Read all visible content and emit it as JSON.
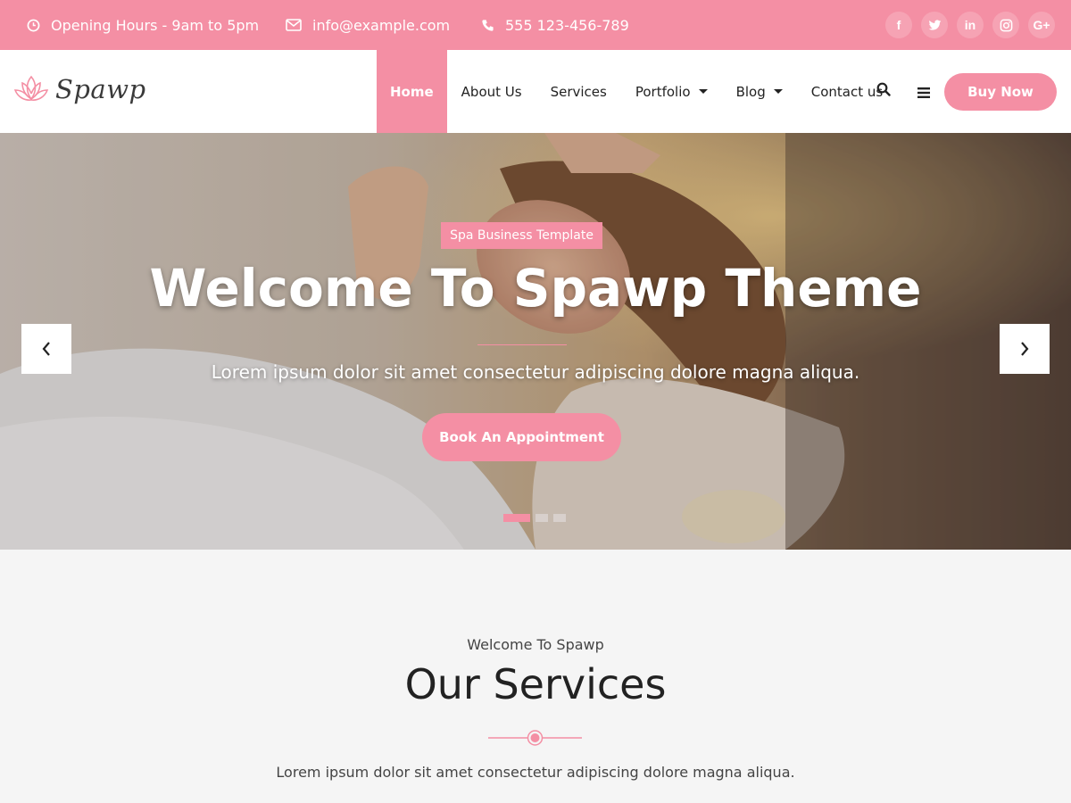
{
  "topbar": {
    "hours": "Opening Hours - 9am to 5pm",
    "email": "info@example.com",
    "phone": "555 123-456-789",
    "social": [
      {
        "icon": "facebook-icon",
        "glyph": "f"
      },
      {
        "icon": "twitter-icon",
        "glyph": "t"
      },
      {
        "icon": "linkedin-icon",
        "glyph": "in"
      },
      {
        "icon": "instagram-icon",
        "glyph": "ig"
      },
      {
        "icon": "google-plus-icon",
        "glyph": "G+"
      }
    ]
  },
  "header": {
    "logo_text": "Spawp",
    "nav": [
      "Home",
      "About Us",
      "Services",
      "Portfolio",
      "Blog",
      "Contact us"
    ],
    "buy_label": "Buy Now"
  },
  "hero": {
    "tag": "Spa Business Template",
    "title": "Welcome To Spawp Theme",
    "subtitle": "Lorem ipsum dolor sit amet consectetur adipiscing dolore magna aliqua.",
    "cta": "Book An Appointment",
    "slide_count": 3,
    "active_slide": 1
  },
  "services": {
    "eyebrow": "Welcome To Spawp",
    "title": "Our Services",
    "text": "Lorem ipsum dolor sit amet consectetur adipiscing dolore magna aliqua."
  },
  "colors": {
    "accent": "#f48fa4",
    "dark": "#222222",
    "light_bg": "#f5f5f5"
  }
}
